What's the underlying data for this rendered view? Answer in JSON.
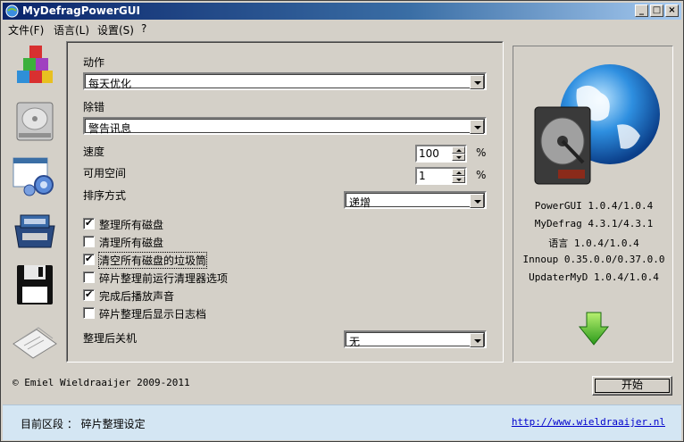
{
  "window": {
    "title": "MyDefragPowerGUI",
    "accent": "#0a246a"
  },
  "menu": [
    "文件(F)",
    "语言(L)",
    "设置(S)",
    "?"
  ],
  "nav_icons": [
    "defrag-blocks-icon",
    "hard-drive-icon",
    "settings-window-icon",
    "toolbox-icon",
    "floppy-disk-icon",
    "log-papers-icon"
  ],
  "action": {
    "label": "动作",
    "value": "每天优化"
  },
  "debug": {
    "label": "除错",
    "value": "警告讯息"
  },
  "speed": {
    "label": "速度",
    "value": "100",
    "unit": "%"
  },
  "free_space": {
    "label": "可用空间",
    "value": "1",
    "unit": "%"
  },
  "sort": {
    "label": "排序方式",
    "value": "递增"
  },
  "options": [
    {
      "label": "整理所有磁盘",
      "checked": true
    },
    {
      "label": "清理所有磁盘",
      "checked": false
    },
    {
      "label": "清空所有磁盘的垃圾筒",
      "checked": true
    },
    {
      "label": "碎片整理前运行清理器选项",
      "checked": false
    },
    {
      "label": "完成后播放声音",
      "checked": true
    },
    {
      "label": "碎片整理后显示日志档",
      "checked": false
    }
  ],
  "shutdown": {
    "label": "整理后关机",
    "value": "无"
  },
  "versions": [
    "PowerGUI 1.0.4/1.0.4",
    "MyDefrag 4.3.1/4.3.1",
    "语言 1.0.4/1.0.4",
    "Innoup 0.35.0.0/0.37.0.0",
    "UpdaterMyD 1.0.4/1.0.4"
  ],
  "copyright": "© Emiel Wieldraaijer 2009-2011",
  "start_button": "开始",
  "status": {
    "text": "目前区段 ： 碎片整理设定",
    "link": "http://www.wieldraaijer.nl"
  }
}
